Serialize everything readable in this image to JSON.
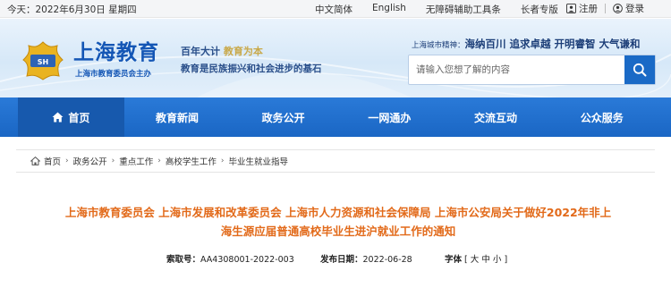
{
  "topbar": {
    "date": "今天：2022年6月30日 星期四",
    "links": [
      "中文简体",
      "English",
      "无障碍辅助工具条",
      "长者专版"
    ],
    "register": "注册",
    "login": "登录"
  },
  "header": {
    "logo_text": "上海教育",
    "logo_sub": "上海市教育委员会主办",
    "slogan1_a": "百年大计",
    "slogan1_b": "教育为本",
    "slogan2": "教育是民族振兴和社会进步的基石",
    "city_spirit_label": "上海城市精神：",
    "city_spirit_value": "海纳百川 追求卓越 开明睿智 大气谦和"
  },
  "search": {
    "placeholder": "请输入您想了解的内容"
  },
  "nav": {
    "items": [
      "首页",
      "教育新闻",
      "政务公开",
      "一网通办",
      "交流互动",
      "公众服务"
    ]
  },
  "breadcrumb": [
    "首页",
    "政务公开",
    "重点工作",
    "高校学生工作",
    "毕业生就业指导"
  ],
  "article": {
    "title_line1": "上海市教育委员会 上海市发展和改革委员会 上海市人力资源和社会保障局 上海市公安局关于做好2022年非上",
    "title_line2": "海生源应届普通高校毕业生进沪就业工作的通知",
    "index_label": "索取号：",
    "index_value": "AA4308001-2022-003",
    "date_label": "发布日期：",
    "date_value": "2022-06-28",
    "font_label": "字体",
    "font_open": "[",
    "font_large": "大",
    "font_medium": "中",
    "font_small": "小",
    "font_close": "]"
  },
  "colors": {
    "brand_blue": "#1e6fcf",
    "title_orange": "#e26a1a"
  }
}
